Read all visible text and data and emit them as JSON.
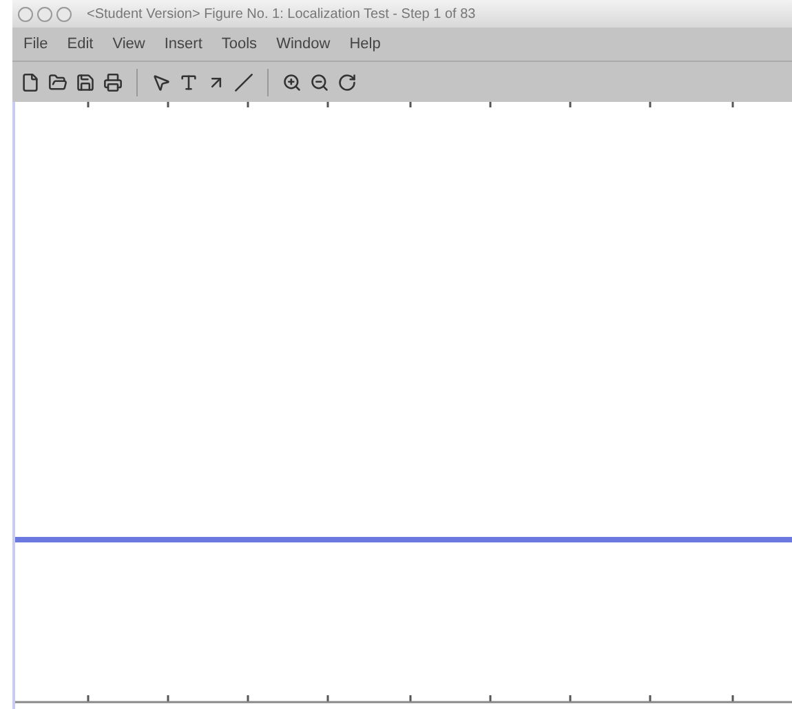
{
  "window": {
    "title": "<Student Version> Figure No. 1: Localization Test - Step 1 of 83"
  },
  "menu": [
    "File",
    "Edit",
    "View",
    "Insert",
    "Tools",
    "Window",
    "Help"
  ]
}
